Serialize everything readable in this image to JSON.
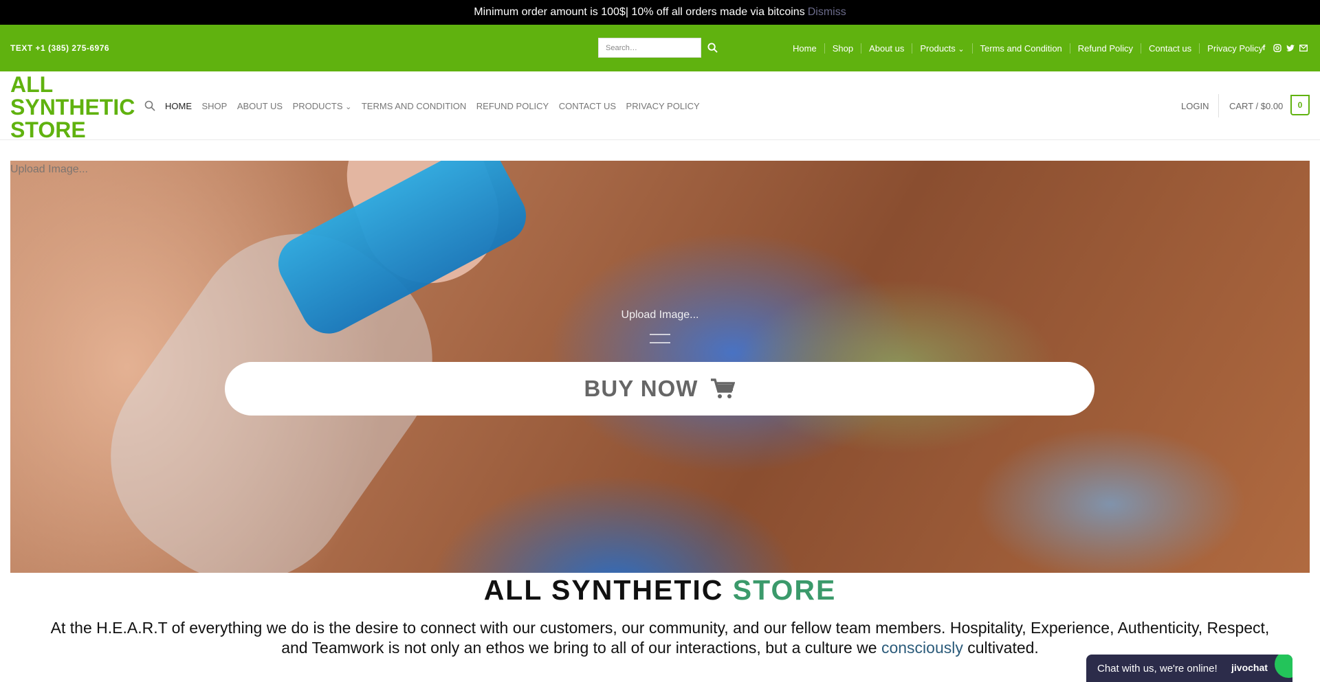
{
  "notice": {
    "text": "Minimum order amount is 100$| 10% off all orders made via bitcoins",
    "dismiss": "Dismiss"
  },
  "topbar": {
    "phone": "TEXT +1 (385) 275-6976",
    "search_placeholder": "Search…",
    "nav": [
      "Home",
      "Shop",
      "About us",
      "Products",
      "Terms and Condition",
      "Refund Policy",
      "Contact us",
      "Privacy Policy"
    ],
    "products_chevron": "⌄",
    "socials": [
      "facebook-icon",
      "instagram-icon",
      "twitter-icon",
      "email-icon"
    ]
  },
  "header": {
    "logo": "ALL SYNTHETIC STORE",
    "nav": [
      "HOME",
      "SHOP",
      "ABOUT US",
      "PRODUCTS",
      "TERMS AND CONDITION",
      "REFUND POLICY",
      "CONTACT US",
      "PRIVACY POLICY"
    ],
    "products_chevron": "⌄",
    "login": "LOGIN",
    "cart": "CART / $0.00",
    "cart_count": "0"
  },
  "hero": {
    "upload_top": "Upload Image...",
    "upload_mid": "Upload Image...",
    "buy": "BUY NOW"
  },
  "content": {
    "title_main": "ALL SYNTHETIC",
    "title_accent": "STORE",
    "about_before": "At the H.E.A.R.T of everything we do is the desire to connect with our customers, our community, and our fellow team members. Hospitality, Experience, Authenticity, Respect, and Teamwork is not only an ethos we bring to all of our interactions, but a culture we",
    "about_link": "consciously",
    "about_after": "cultivated."
  },
  "chat": {
    "text": "Chat with us, we're online!",
    "brand": "jivochat"
  },
  "colors": {
    "brand_green": "#60b20f",
    "accent_teal": "#3b9a6b",
    "chat_bg": "#2c2c4a"
  }
}
